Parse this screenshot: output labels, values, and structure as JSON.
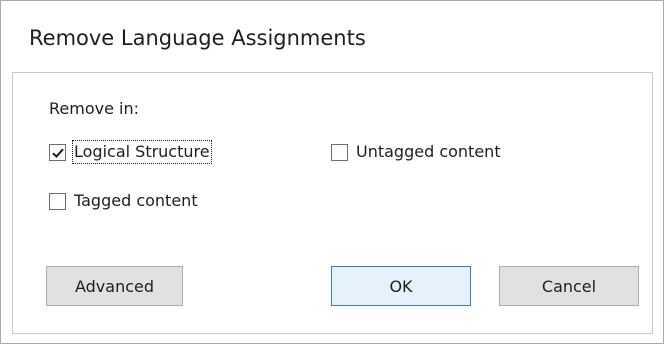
{
  "dialog": {
    "title": "Remove Language Assignments",
    "remove_in_label": "Remove in:",
    "options": {
      "logical_structure": {
        "label": "Logical Structure",
        "checked": true
      },
      "untagged_content": {
        "label": "Untagged content",
        "checked": false
      },
      "tagged_content": {
        "label": "Tagged content",
        "checked": false
      }
    },
    "buttons": {
      "advanced": "Advanced",
      "ok": "OK",
      "cancel": "Cancel"
    }
  }
}
